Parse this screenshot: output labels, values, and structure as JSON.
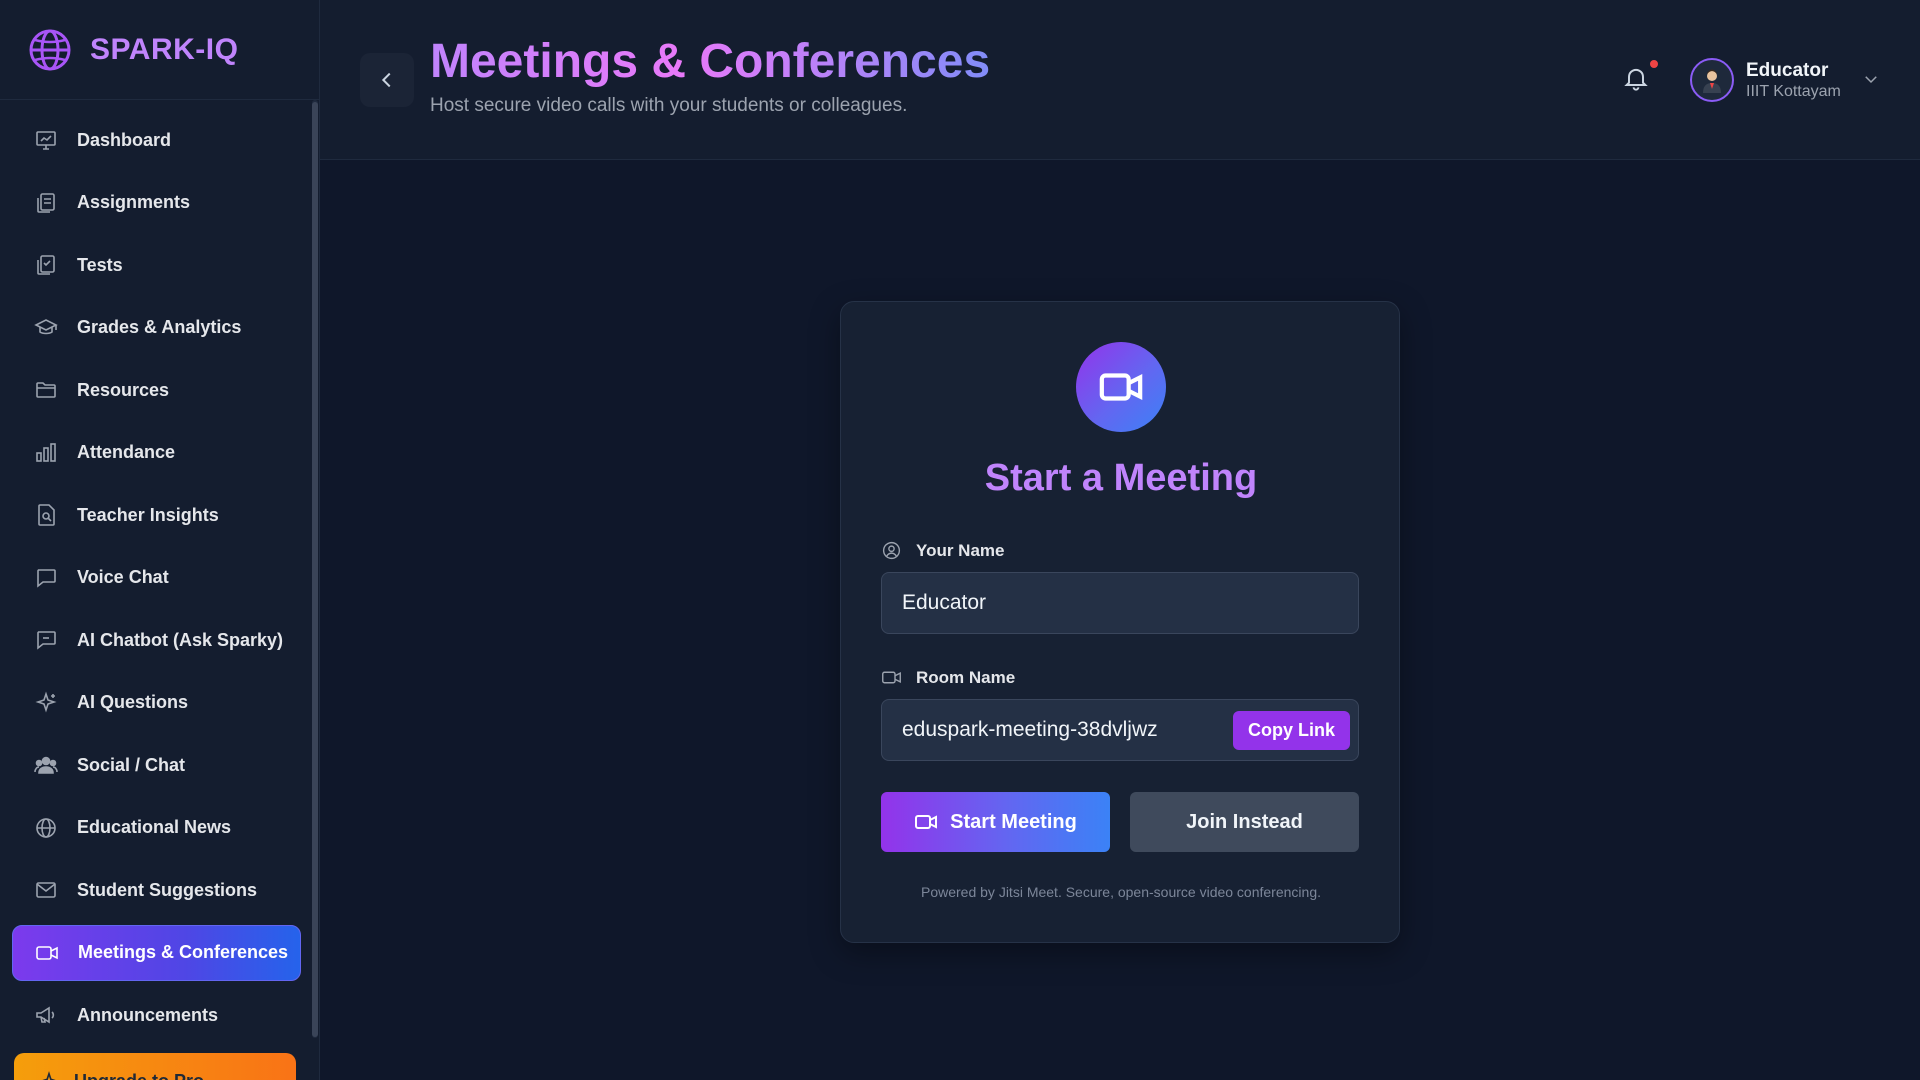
{
  "brand": {
    "name": "SPARK-IQ"
  },
  "sidebar": {
    "items": [
      {
        "label": "Dashboard",
        "icon": "dashboard-icon"
      },
      {
        "label": "Assignments",
        "icon": "assignments-icon"
      },
      {
        "label": "Tests",
        "icon": "tests-icon"
      },
      {
        "label": "Grades & Analytics",
        "icon": "graduation-cap-icon"
      },
      {
        "label": "Resources",
        "icon": "folder-icon"
      },
      {
        "label": "Attendance",
        "icon": "bar-chart-icon"
      },
      {
        "label": "Teacher Insights",
        "icon": "file-search-icon"
      },
      {
        "label": "Voice Chat",
        "icon": "chat-bubble-icon"
      },
      {
        "label": "AI Chatbot (Ask Sparky)",
        "icon": "chatbot-icon"
      },
      {
        "label": "AI Questions",
        "icon": "sparkles-icon"
      },
      {
        "label": "Social / Chat",
        "icon": "users-icon"
      },
      {
        "label": "Educational News",
        "icon": "globe-icon"
      },
      {
        "label": "Student Suggestions",
        "icon": "mail-icon"
      },
      {
        "label": "Meetings & Conferences",
        "icon": "video-icon",
        "active": true
      },
      {
        "label": "Announcements",
        "icon": "megaphone-icon"
      }
    ],
    "upgrade_label": "Upgrade to Pro"
  },
  "header": {
    "title": "Meetings & Conferences",
    "subtitle": "Host secure video calls with your students or colleagues.",
    "user": {
      "name": "Educator",
      "org": "IIIT Kottayam"
    }
  },
  "meeting": {
    "title": "Start a Meeting",
    "name_label": "Your Name",
    "name_value": "Educator",
    "room_label": "Room Name",
    "room_value": "eduspark-meeting-38dvljwz",
    "copy_label": "Copy Link",
    "start_label": "Start Meeting",
    "join_label": "Join Instead",
    "powered_by": "Powered by Jitsi Meet. Secure, open-source video conferencing."
  },
  "colors": {
    "accent_purple": "#9333ea",
    "accent_blue": "#3b82f6",
    "background": "#0f172a",
    "sidebar_bg": "#141d2f",
    "notification_dot": "#ef4444"
  }
}
